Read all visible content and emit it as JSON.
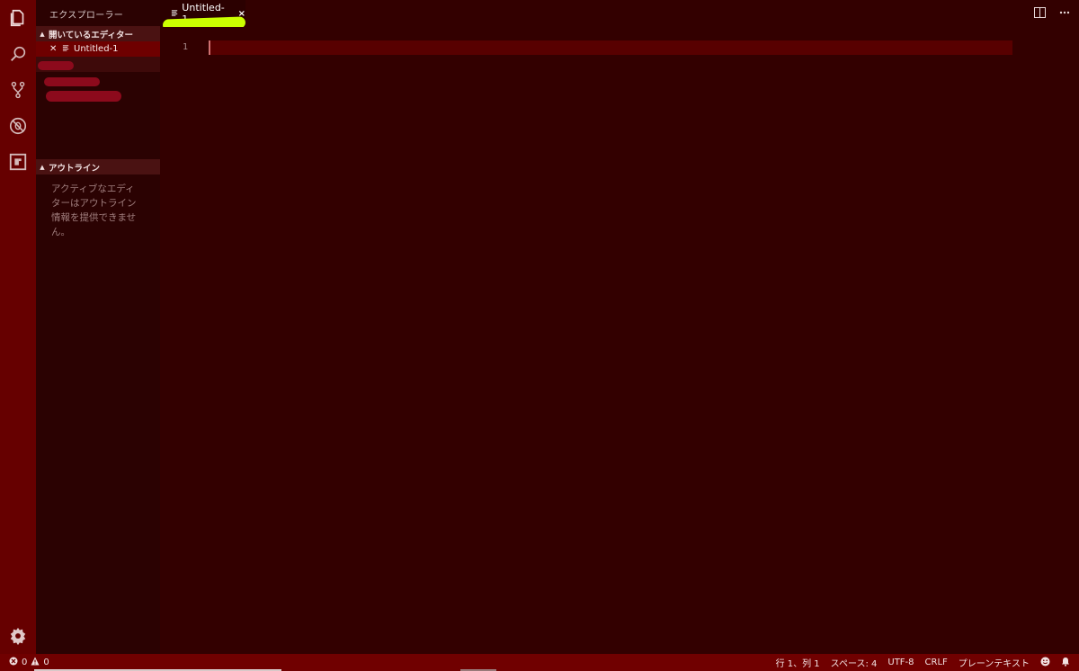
{
  "colors": {
    "activity_bar": "#660000",
    "sidebar": "#2b0202",
    "editor_bg": "#330000",
    "status_bar": "#700000",
    "highlight": "#ccff00"
  },
  "activity_bar": {
    "icons": [
      "explorer-icon",
      "search-icon",
      "source-control-icon",
      "debug-icon",
      "extensions-icon"
    ],
    "bottom_icon": "gear-icon"
  },
  "sidebar": {
    "title": "エクスプローラー",
    "open_editors": {
      "header": "開いているエディター",
      "items": [
        {
          "label": "Untitled-1"
        }
      ]
    },
    "outline": {
      "header": "アウトライン",
      "message": "アクティブなエディターはアウトライン情報を提供できません。"
    }
  },
  "tabs": [
    {
      "label": "Untitled-1",
      "close": "×"
    }
  ],
  "editor": {
    "line_numbers": [
      "1"
    ]
  },
  "status_bar": {
    "errors": "0",
    "warnings": "0",
    "position": "行 1、列 1",
    "spaces": "スペース: 4",
    "encoding": "UTF-8",
    "eol": "CRLF",
    "language": "プレーンテキスト"
  }
}
